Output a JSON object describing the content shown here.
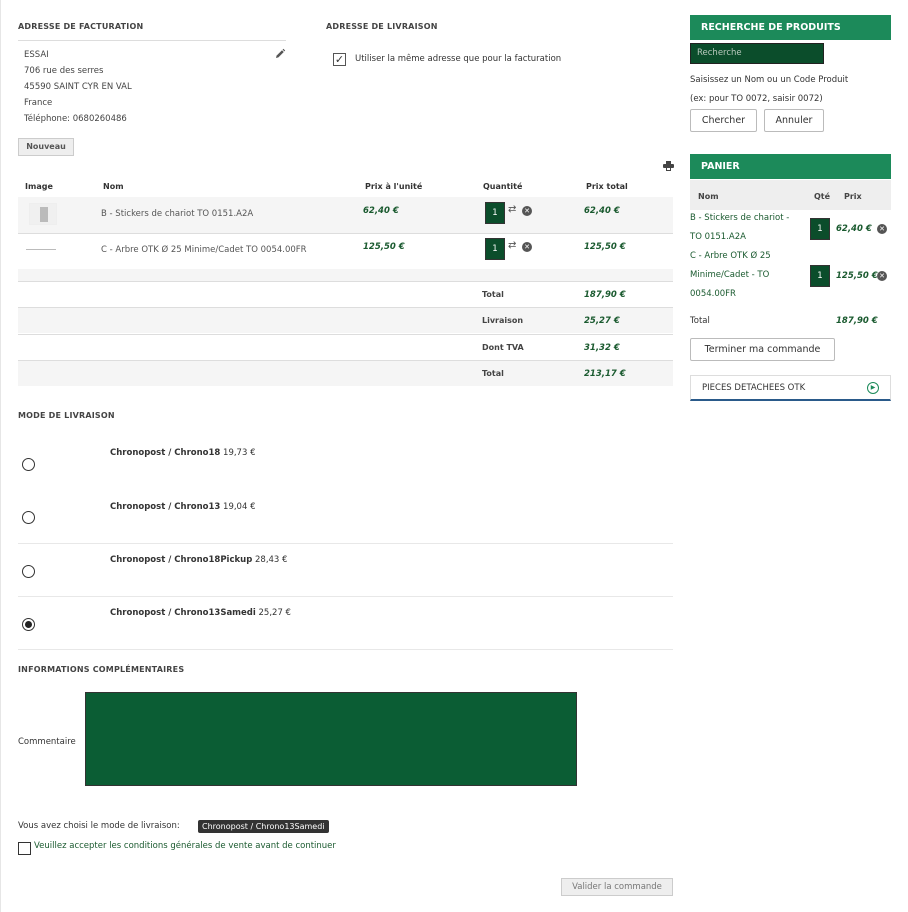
{
  "billing": {
    "heading": "ADRESSE DE FACTURATION",
    "lines": [
      "ESSAI",
      "706 rue des serres",
      "45590 SAINT CYR EN VAL",
      "France",
      "Téléphone: 0680260486"
    ]
  },
  "shipping": {
    "heading": "ADRESSE DE LIVRAISON",
    "same_label": "Utiliser la même adresse que pour la facturation",
    "same_checked": "✓"
  },
  "new_button": "Nouveau",
  "cart": {
    "headers": {
      "image": "Image",
      "name": "Nom",
      "unit": "Prix à l'unité",
      "qty": "Quantité",
      "total": "Prix total"
    },
    "rows": [
      {
        "name": "B - Stickers de chariot TO 0151.A2A",
        "unit": "62,40 €",
        "qty": "1",
        "total": "62,40 €"
      },
      {
        "name": "C - Arbre OTK Ø 25 Minime/Cadet TO 0054.00FR",
        "unit": "125,50 €",
        "qty": "1",
        "total": "125,50 €"
      }
    ],
    "summary": [
      {
        "label": "Total",
        "value": "187,90 €"
      },
      {
        "label": "Livraison",
        "value": "25,27 €"
      },
      {
        "label": "Dont TVA",
        "value": "31,32 €"
      },
      {
        "label": "Total",
        "value": "213,17 €"
      }
    ]
  },
  "delivery": {
    "heading": "MODE DE LIVRAISON",
    "options": [
      {
        "name": "Chronopost / Chrono18",
        "price": "19,73 €",
        "selected": false
      },
      {
        "name": "Chronopost / Chrono13",
        "price": "19,04 €",
        "selected": false
      },
      {
        "name": "Chronopost / Chrono18Pickup",
        "price": "28,43 €",
        "selected": false
      },
      {
        "name": "Chronopost / Chrono13Samedi",
        "price": "25,27 €",
        "selected": true
      }
    ]
  },
  "info": {
    "heading": "INFORMATIONS COMPLÉMENTAIRES",
    "comment_label": "Commentaire",
    "comment_value": ""
  },
  "chosen": {
    "text": "Vous avez choisi le mode de livraison:",
    "badge": "Chronopost / Chrono13Samedi"
  },
  "cgv_label": "Veuillez accepter les conditions générales de vente avant de continuer",
  "validate_button": "Valider la commande",
  "sidebar": {
    "search_heading": "RECHERCHE DE PRODUITS",
    "search_placeholder": "Recherche",
    "hint1": "Saisissez un Nom ou un Code Produit",
    "hint2": "(ex: pour TO 0072, saisir 0072)",
    "search_button": "Chercher",
    "cancel_button": "Annuler",
    "panier_heading": "PANIER",
    "panier_headers": {
      "name": "Nom",
      "qty": "Qté",
      "price": "Prix"
    },
    "panier_items": [
      {
        "line1": "B - Stickers de chariot -",
        "line2": "TO 0151.A2A",
        "qty": "1",
        "price": "62,40 €"
      },
      {
        "line1": "C - Arbre OTK Ø 25",
        "line2": "Minime/Cadet - TO",
        "line3": "0054.00FR",
        "qty": "1",
        "price": "125,50 €"
      }
    ],
    "panier_total_label": "Total",
    "panier_total_value": "187,90 €",
    "finish_button": "Terminer ma commande",
    "pieces_label": "PIECES DETACHEES OTK"
  },
  "colors": {
    "accent": "#1c8a5a",
    "dark_green": "#0b4d2b",
    "price_green": "#1a5a2f"
  },
  "icons": {
    "edit": "pencil-icon",
    "print": "print-icon",
    "refresh": "refresh-icon",
    "remove": "remove-icon",
    "play": "play-circle-icon"
  }
}
